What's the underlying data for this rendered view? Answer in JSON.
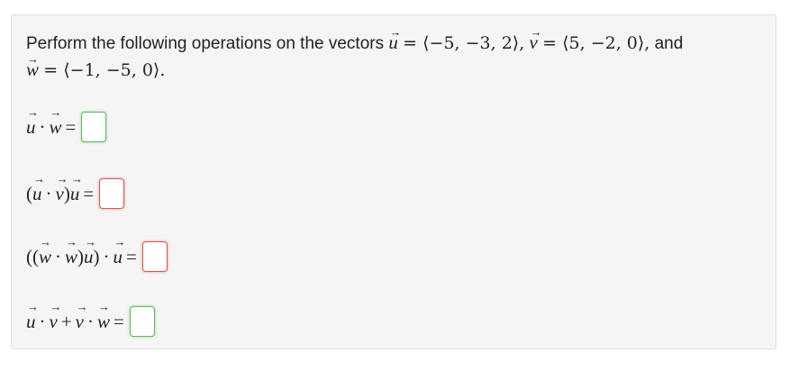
{
  "problem": {
    "intro_text": "Perform the following operations on the vectors",
    "u_def": "= ⟨−5, −3, 2⟩,",
    "v_def": "= ⟨5, −2, 0⟩,",
    "and_word": "and",
    "w_def": "= ⟨−1, −5, 0⟩."
  },
  "questions": [
    {
      "label_parts": [
        "u",
        "·",
        "w",
        "="
      ],
      "status": "correct"
    },
    {
      "label_parts": [
        "(",
        "u",
        "·",
        "v",
        ")",
        "u",
        "="
      ],
      "status": "incorrect"
    },
    {
      "label_parts": [
        "((",
        "w",
        "·",
        "w",
        ")",
        "u",
        ")",
        "·",
        "u",
        "="
      ],
      "status": "incorrect"
    },
    {
      "label_parts": [
        "u",
        "·",
        "v",
        "+",
        "v",
        "·",
        "w",
        "="
      ],
      "status": "correct"
    }
  ],
  "colors": {
    "correct": "#5cb85c",
    "incorrect": "#d9534f"
  }
}
